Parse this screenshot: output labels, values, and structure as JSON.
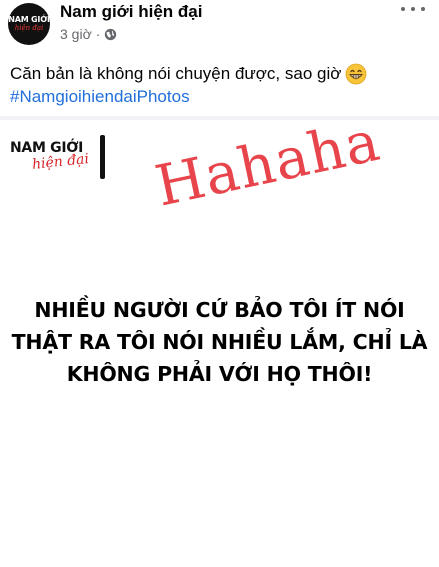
{
  "post": {
    "page_name": "Nam giới hiện đại",
    "time": "3 giờ",
    "separator": "·",
    "privacy_icon": "globe-icon",
    "more_icon": "more-options-icon",
    "avatar": {
      "line1": "NAM GIỚI",
      "line2": "hiện đại"
    },
    "caption": "Căn bản là không nói chuyện được, sao giờ",
    "caption_emoji": "grinning-face-icon",
    "hashtag": "#NamgioihiendaiPhotos"
  },
  "image": {
    "logo_line1": "NAM GIỚI",
    "logo_line2": "hiện đại",
    "overlay_text": "Hahaha",
    "headline": [
      "NHIỀU NGƯỜI CỨ BẢO TÔI ÍT NÓI",
      "THẬT RA TÔI NÓI NHIỀU LẮM, CHỈ LÀ",
      "KHÔNG PHẢI VỚI HỌ THÔI!"
    ]
  },
  "colors": {
    "link": "#216fdb",
    "meta_gray": "#65676b",
    "overlay_red": "#e8444b",
    "logo_red": "#d7262b",
    "background": "#f0f2f5"
  }
}
